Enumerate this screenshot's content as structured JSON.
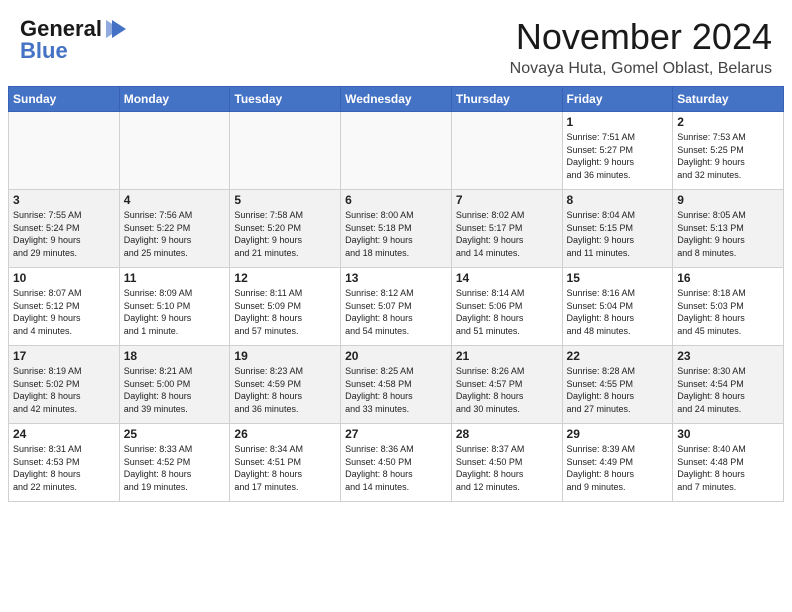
{
  "header": {
    "logo_line1": "General",
    "logo_line2": "Blue",
    "month_title": "November 2024",
    "location": "Novaya Huta, Gomel Oblast, Belarus"
  },
  "days_of_week": [
    "Sunday",
    "Monday",
    "Tuesday",
    "Wednesday",
    "Thursday",
    "Friday",
    "Saturday"
  ],
  "weeks": [
    [
      {
        "day": "",
        "info": ""
      },
      {
        "day": "",
        "info": ""
      },
      {
        "day": "",
        "info": ""
      },
      {
        "day": "",
        "info": ""
      },
      {
        "day": "",
        "info": ""
      },
      {
        "day": "1",
        "info": "Sunrise: 7:51 AM\nSunset: 5:27 PM\nDaylight: 9 hours\nand 36 minutes."
      },
      {
        "day": "2",
        "info": "Sunrise: 7:53 AM\nSunset: 5:25 PM\nDaylight: 9 hours\nand 32 minutes."
      }
    ],
    [
      {
        "day": "3",
        "info": "Sunrise: 7:55 AM\nSunset: 5:24 PM\nDaylight: 9 hours\nand 29 minutes."
      },
      {
        "day": "4",
        "info": "Sunrise: 7:56 AM\nSunset: 5:22 PM\nDaylight: 9 hours\nand 25 minutes."
      },
      {
        "day": "5",
        "info": "Sunrise: 7:58 AM\nSunset: 5:20 PM\nDaylight: 9 hours\nand 21 minutes."
      },
      {
        "day": "6",
        "info": "Sunrise: 8:00 AM\nSunset: 5:18 PM\nDaylight: 9 hours\nand 18 minutes."
      },
      {
        "day": "7",
        "info": "Sunrise: 8:02 AM\nSunset: 5:17 PM\nDaylight: 9 hours\nand 14 minutes."
      },
      {
        "day": "8",
        "info": "Sunrise: 8:04 AM\nSunset: 5:15 PM\nDaylight: 9 hours\nand 11 minutes."
      },
      {
        "day": "9",
        "info": "Sunrise: 8:05 AM\nSunset: 5:13 PM\nDaylight: 9 hours\nand 8 minutes."
      }
    ],
    [
      {
        "day": "10",
        "info": "Sunrise: 8:07 AM\nSunset: 5:12 PM\nDaylight: 9 hours\nand 4 minutes."
      },
      {
        "day": "11",
        "info": "Sunrise: 8:09 AM\nSunset: 5:10 PM\nDaylight: 9 hours\nand 1 minute."
      },
      {
        "day": "12",
        "info": "Sunrise: 8:11 AM\nSunset: 5:09 PM\nDaylight: 8 hours\nand 57 minutes."
      },
      {
        "day": "13",
        "info": "Sunrise: 8:12 AM\nSunset: 5:07 PM\nDaylight: 8 hours\nand 54 minutes."
      },
      {
        "day": "14",
        "info": "Sunrise: 8:14 AM\nSunset: 5:06 PM\nDaylight: 8 hours\nand 51 minutes."
      },
      {
        "day": "15",
        "info": "Sunrise: 8:16 AM\nSunset: 5:04 PM\nDaylight: 8 hours\nand 48 minutes."
      },
      {
        "day": "16",
        "info": "Sunrise: 8:18 AM\nSunset: 5:03 PM\nDaylight: 8 hours\nand 45 minutes."
      }
    ],
    [
      {
        "day": "17",
        "info": "Sunrise: 8:19 AM\nSunset: 5:02 PM\nDaylight: 8 hours\nand 42 minutes."
      },
      {
        "day": "18",
        "info": "Sunrise: 8:21 AM\nSunset: 5:00 PM\nDaylight: 8 hours\nand 39 minutes."
      },
      {
        "day": "19",
        "info": "Sunrise: 8:23 AM\nSunset: 4:59 PM\nDaylight: 8 hours\nand 36 minutes."
      },
      {
        "day": "20",
        "info": "Sunrise: 8:25 AM\nSunset: 4:58 PM\nDaylight: 8 hours\nand 33 minutes."
      },
      {
        "day": "21",
        "info": "Sunrise: 8:26 AM\nSunset: 4:57 PM\nDaylight: 8 hours\nand 30 minutes."
      },
      {
        "day": "22",
        "info": "Sunrise: 8:28 AM\nSunset: 4:55 PM\nDaylight: 8 hours\nand 27 minutes."
      },
      {
        "day": "23",
        "info": "Sunrise: 8:30 AM\nSunset: 4:54 PM\nDaylight: 8 hours\nand 24 minutes."
      }
    ],
    [
      {
        "day": "24",
        "info": "Sunrise: 8:31 AM\nSunset: 4:53 PM\nDaylight: 8 hours\nand 22 minutes."
      },
      {
        "day": "25",
        "info": "Sunrise: 8:33 AM\nSunset: 4:52 PM\nDaylight: 8 hours\nand 19 minutes."
      },
      {
        "day": "26",
        "info": "Sunrise: 8:34 AM\nSunset: 4:51 PM\nDaylight: 8 hours\nand 17 minutes."
      },
      {
        "day": "27",
        "info": "Sunrise: 8:36 AM\nSunset: 4:50 PM\nDaylight: 8 hours\nand 14 minutes."
      },
      {
        "day": "28",
        "info": "Sunrise: 8:37 AM\nSunset: 4:50 PM\nDaylight: 8 hours\nand 12 minutes."
      },
      {
        "day": "29",
        "info": "Sunrise: 8:39 AM\nSunset: 4:49 PM\nDaylight: 8 hours\nand 9 minutes."
      },
      {
        "day": "30",
        "info": "Sunrise: 8:40 AM\nSunset: 4:48 PM\nDaylight: 8 hours\nand 7 minutes."
      }
    ]
  ]
}
